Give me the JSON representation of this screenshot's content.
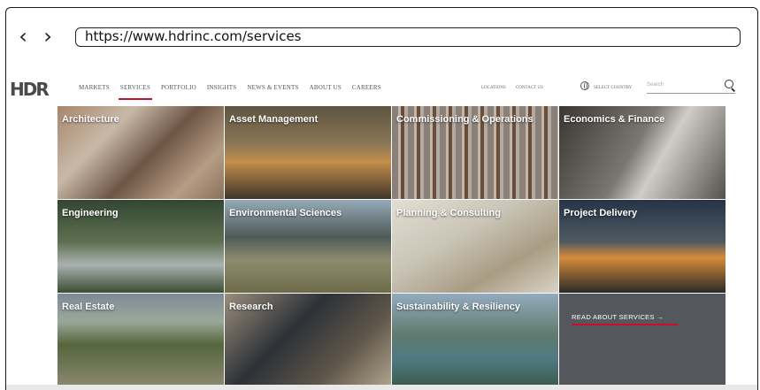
{
  "browser": {
    "back_icon": "‹",
    "forward_icon": "›",
    "url": "https://www.hdrinc.com/services"
  },
  "site": {
    "logo": "HDR",
    "nav": [
      "MARKETS",
      "SERVICES",
      "PORTFOLIO",
      "INSIGHTS",
      "NEWS & EVENTS",
      "ABOUT US",
      "CAREERS"
    ],
    "active_nav": "SERVICES",
    "utility": {
      "locations": "LOCATIONS",
      "contact": "CONTACT US",
      "country": "SELECT COUNTRY",
      "search_placeholder": "Search"
    }
  },
  "tiles": [
    {
      "label": "Architecture"
    },
    {
      "label": "Asset Management"
    },
    {
      "label": "Commissioning & Operations"
    },
    {
      "label": "Economics & Finance"
    },
    {
      "label": "Engineering"
    },
    {
      "label": "Environmental Sciences"
    },
    {
      "label": "Planning & Consulting"
    },
    {
      "label": "Project Delivery"
    },
    {
      "label": "Real Estate"
    },
    {
      "label": "Research"
    },
    {
      "label": "Sustainability & Resiliency"
    }
  ],
  "read_about": "READ ABOUT SERVICES  →",
  "colors": {
    "accent": "#c8102e",
    "read_tile_bg": "#54575c"
  }
}
